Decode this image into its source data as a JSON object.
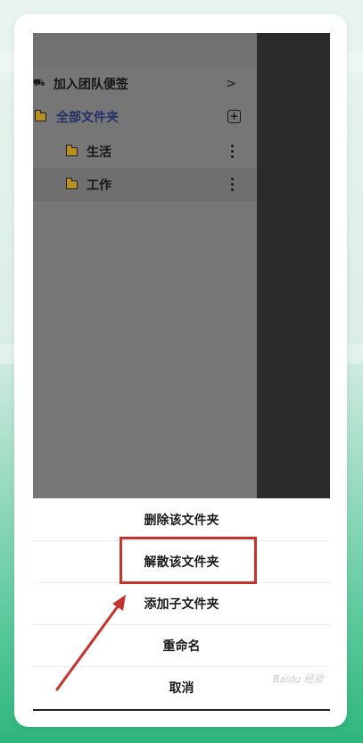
{
  "colors": {
    "highlight": "#c6322c",
    "folder": "#b8901e",
    "overlay": "#2b2b2b"
  },
  "drawer": {
    "team_item": {
      "label": "加入团队便签",
      "icon": "team-icon",
      "chevron": ">"
    },
    "all_folders": {
      "label": "全部文件夹",
      "icon": "folder-icon",
      "action_icon": "add-folder-icon"
    },
    "folders": [
      {
        "label": "生活",
        "icon": "folder-icon",
        "selected": false
      },
      {
        "label": "工作",
        "icon": "folder-icon",
        "selected": true
      }
    ]
  },
  "action_sheet": {
    "items": [
      {
        "label": "删除该文件夹"
      },
      {
        "label": "解散该文件夹",
        "highlighted": true
      },
      {
        "label": "添加子文件夹"
      },
      {
        "label": "重命名"
      },
      {
        "label": "取消"
      }
    ]
  },
  "watermark": "Baidu 经验"
}
